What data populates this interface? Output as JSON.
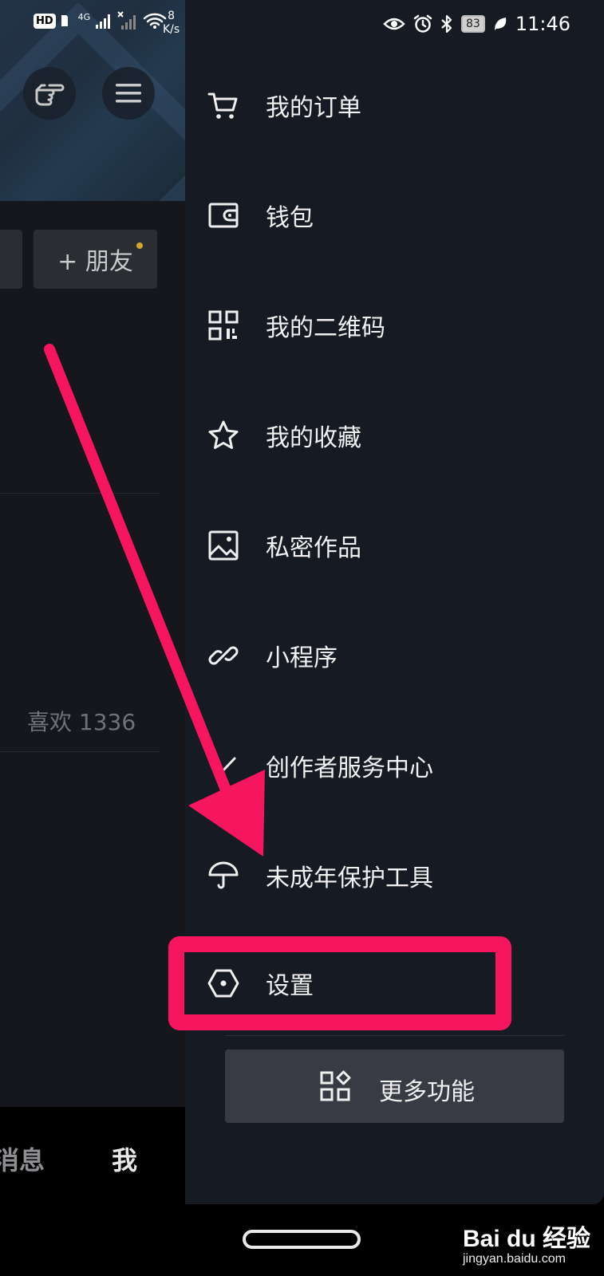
{
  "status_bar": {
    "hd_label": "HD",
    "network": "4G",
    "net_speed_value": "8",
    "net_speed_unit": "K/s",
    "battery": "83",
    "time": "11:46"
  },
  "background": {
    "add_friend_label": "+ 朋友",
    "likes_label": "喜欢 1336",
    "nav_messages_label": "消息",
    "nav_me_label": "我"
  },
  "drawer": {
    "items": [
      {
        "label": "我的订单",
        "icon": "cart-icon"
      },
      {
        "label": "钱包",
        "icon": "wallet-icon"
      },
      {
        "label": "我的二维码",
        "icon": "qr-code-icon"
      },
      {
        "label": "我的收藏",
        "icon": "star-icon"
      },
      {
        "label": "私密作品",
        "icon": "image-icon"
      },
      {
        "label": "小程序",
        "icon": "link-icon"
      },
      {
        "label": "创作者服务中心",
        "icon": "check-icon"
      },
      {
        "label": "未成年保护工具",
        "icon": "umbrella-icon"
      },
      {
        "label": "设置",
        "icon": "settings-hexagon-icon"
      }
    ],
    "more_label": "更多功能"
  },
  "watermark": {
    "brand": "Bai du 经验",
    "sub": "jingyan.baidu.com"
  },
  "colors": {
    "annotation": "#f5165f",
    "drawer_bg": "#161a22"
  }
}
